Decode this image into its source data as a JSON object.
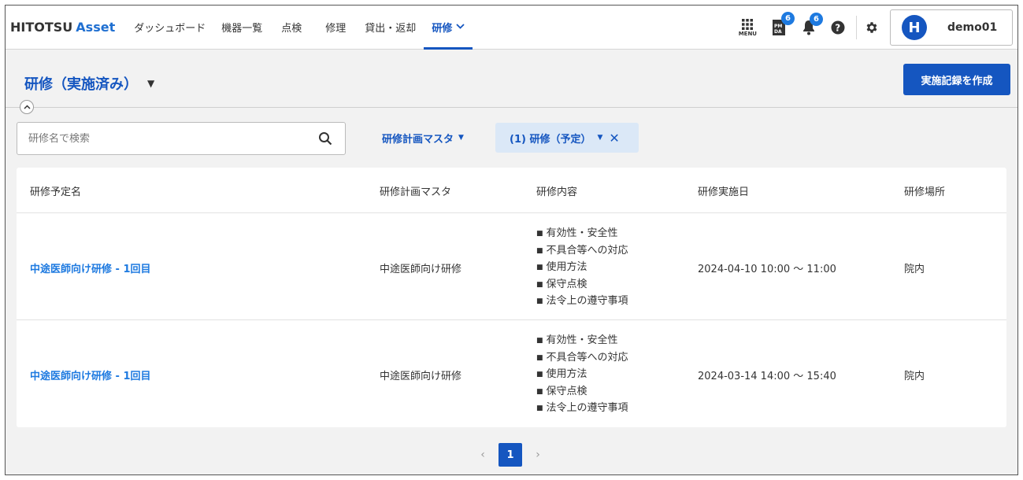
{
  "header": {
    "logo_main": "HITOTSU",
    "logo_accent": "Asset",
    "nav": [
      {
        "label": "ダッシュボード"
      },
      {
        "label": "機器一覧"
      },
      {
        "label": "点検"
      },
      {
        "label": "修理"
      },
      {
        "label": "貸出・返却"
      },
      {
        "label": "研修",
        "active": true
      }
    ],
    "menu_label": "MENU",
    "pmda_badge": "6",
    "notification_badge": "6",
    "user_initial": "H",
    "username": "demo01"
  },
  "page": {
    "title": "研修（実施済み）",
    "create_button": "実施記録を作成"
  },
  "filters": {
    "search_placeholder": "研修名で検索",
    "plan_master_label": "研修計画マスタ",
    "active_chip": "(1) 研修（予定）"
  },
  "table": {
    "headers": [
      "研修予定名",
      "研修計画マスタ",
      "研修内容",
      "研修実施日",
      "研修場所"
    ],
    "rows": [
      {
        "name": "中途医師向け研修 - 1回目",
        "plan": "中途医師向け研修",
        "contents": [
          "有効性・安全性",
          "不具合等への対応",
          "使用方法",
          "保守点検",
          "法令上の遵守事項"
        ],
        "date": "2024-04-10 10:00 ～ 11:00",
        "place": "院内"
      },
      {
        "name": "中途医師向け研修 - 1回目",
        "plan": "中途医師向け研修",
        "contents": [
          "有効性・安全性",
          "不具合等への対応",
          "使用方法",
          "保守点検",
          "法令上の遵守事項"
        ],
        "date": "2024-03-14 14:00 ～ 15:40",
        "place": "院内"
      }
    ]
  },
  "pagination": {
    "current": "1",
    "prev": "‹",
    "next": "›"
  },
  "colors": {
    "primary": "#1556c0",
    "link": "#1e7ae0",
    "chip_bg": "#dbe8f7"
  }
}
